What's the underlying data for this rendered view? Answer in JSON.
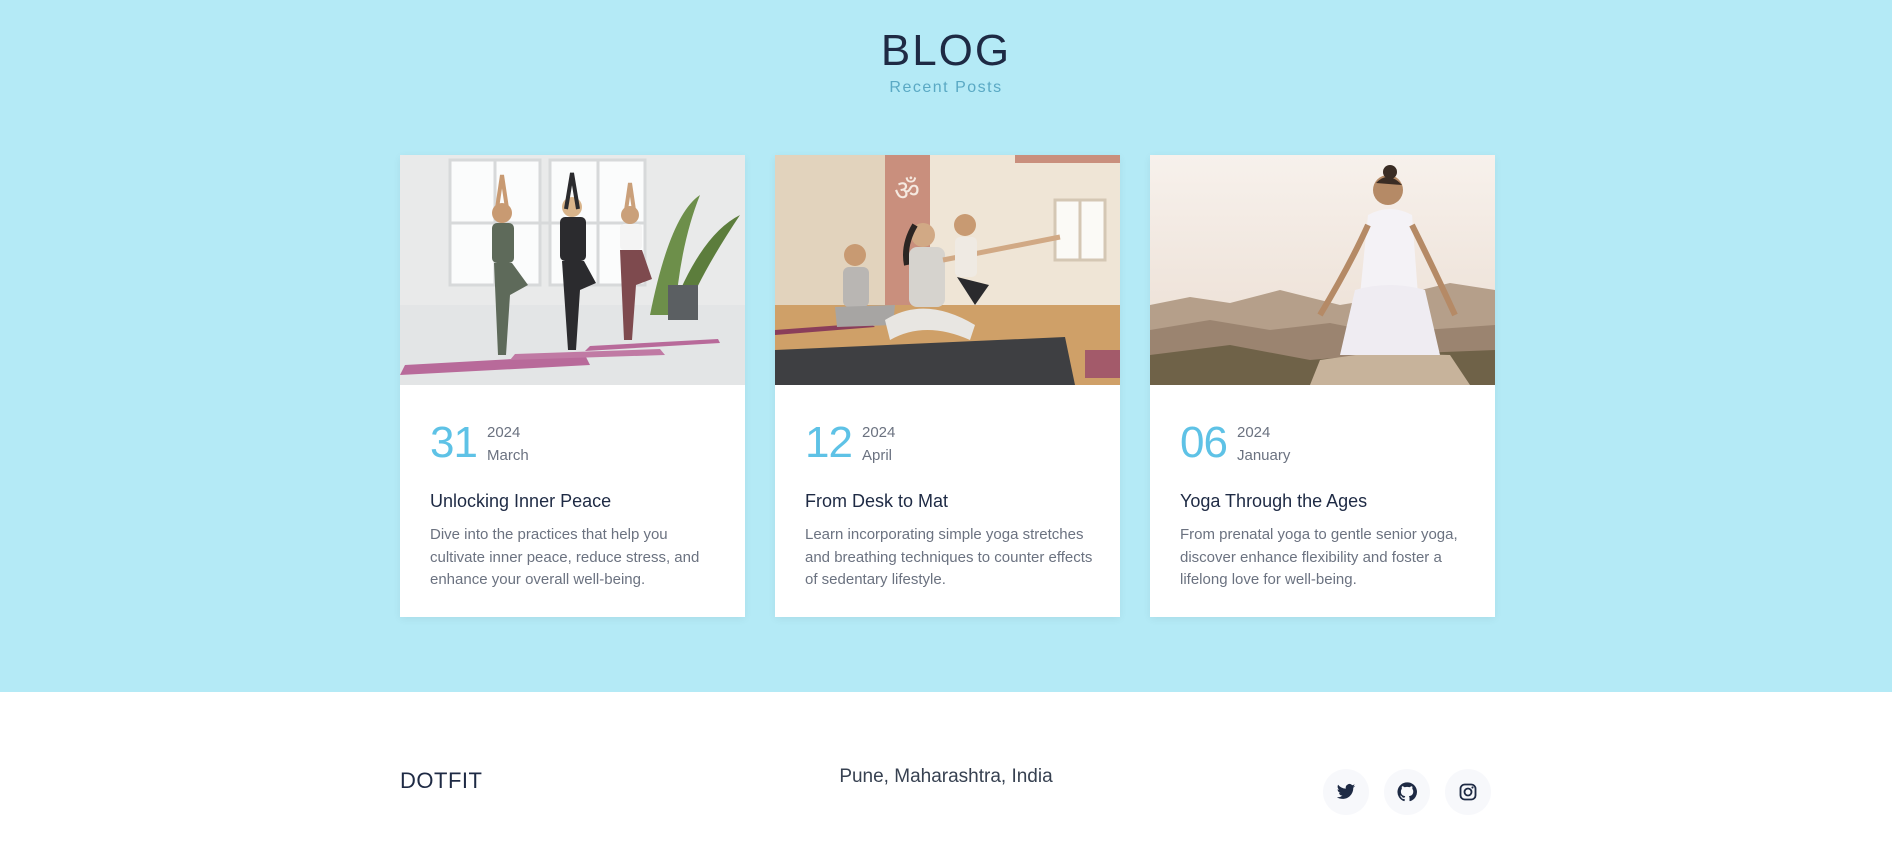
{
  "blog": {
    "title": "BLOG",
    "subtitle": "Recent Posts"
  },
  "posts": [
    {
      "day": "31",
      "year": "2024",
      "month": "March",
      "title": "Unlocking Inner Peace",
      "text": "Dive into the practices that help you cultivate inner peace, reduce stress, and enhance your overall well-being."
    },
    {
      "day": "12",
      "year": "2024",
      "month": "April",
      "title": "From Desk to Mat",
      "text": "Learn incorporating simple yoga stretches and breathing techniques to counter effects of sedentary lifestyle."
    },
    {
      "day": "06",
      "year": "2024",
      "month": "January",
      "title": "Yoga Through the Ages",
      "text": "From prenatal yoga to gentle senior yoga, discover enhance flexibility and foster a lifelong love for well-being."
    }
  ],
  "footer": {
    "brand": "DOTFIT",
    "location": "Pune, Maharashtra, India",
    "socials": [
      {
        "icon": "twitter-icon"
      },
      {
        "icon": "github-icon"
      },
      {
        "icon": "instagram-icon"
      }
    ]
  },
  "colors": {
    "section_background": "#b4eaf6",
    "accent": "#5ec2e6",
    "heading": "#1e2a44"
  }
}
